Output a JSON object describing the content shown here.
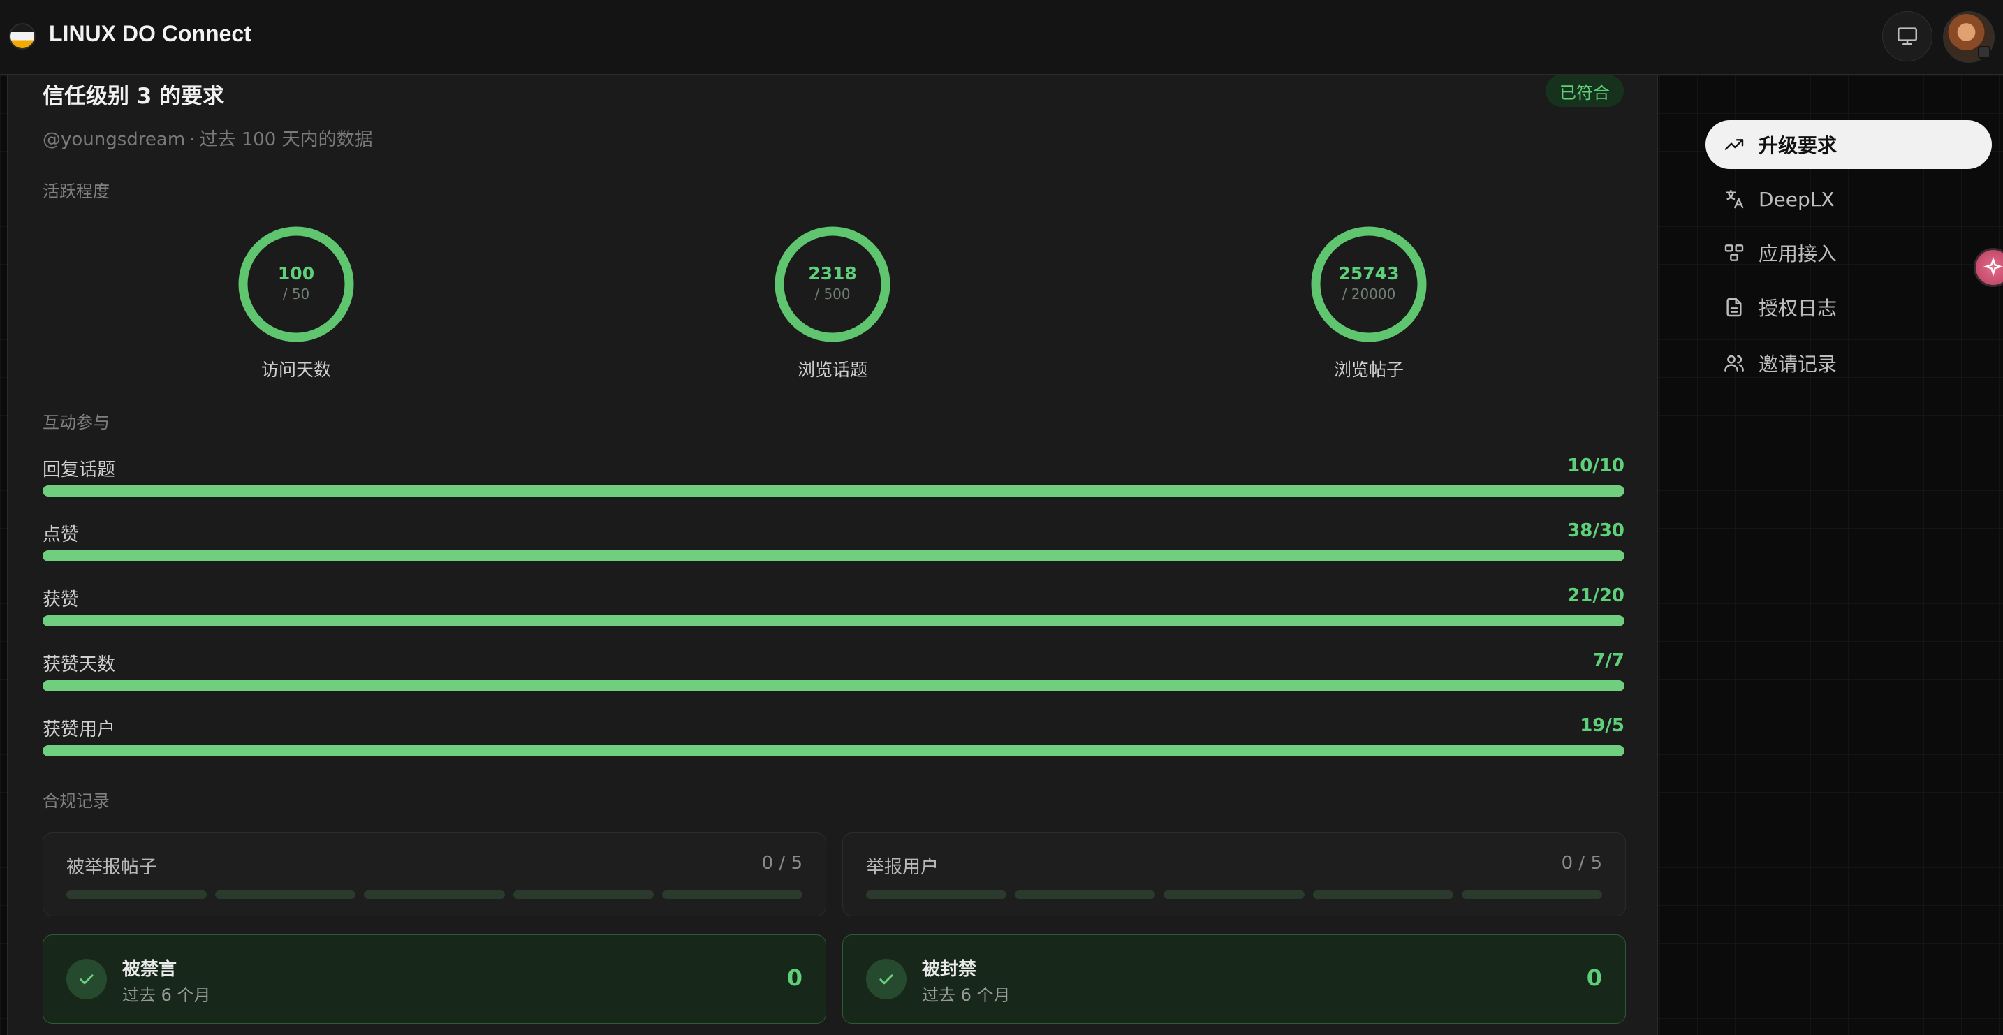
{
  "header": {
    "brand": "LINUX DO Connect",
    "monitor_icon": "monitor-icon",
    "avatar_icon": "user-avatar"
  },
  "panel": {
    "title": "信任级别 3 的要求",
    "status_badge": "已符合",
    "username": "@youngsdream",
    "separator": "·",
    "period": "过去 100 天内的数据",
    "sections": {
      "activity": "活跃程度",
      "interaction": "互动参与",
      "compliance": "合规记录"
    },
    "rings": [
      {
        "value": "100",
        "target": "/ 50",
        "label": "访问天数",
        "progress": 1.0
      },
      {
        "value": "2318",
        "target": "/ 500",
        "label": "浏览话题",
        "progress": 1.0
      },
      {
        "value": "25743",
        "target": "/ 20000",
        "label": "浏览帖子",
        "progress": 1.0
      }
    ],
    "bars": [
      {
        "label": "回复话题",
        "value": "10/10",
        "progress": 1.0
      },
      {
        "label": "点赞",
        "value": "38/30",
        "progress": 1.0
      },
      {
        "label": "获赞",
        "value": "21/20",
        "progress": 1.0
      },
      {
        "label": "获赞天数",
        "value": "7/7",
        "progress": 1.0
      },
      {
        "label": "获赞用户",
        "value": "19/5",
        "progress": 1.0
      }
    ],
    "compliance_cards": [
      {
        "label": "被举报帖子",
        "count": "0 / 5",
        "segments": 5,
        "filled": 0
      },
      {
        "label": "举报用户",
        "count": "0 / 5",
        "segments": 5,
        "filled": 0
      }
    ],
    "status_cards": [
      {
        "title": "被禁言",
        "subtitle": "过去 6 个月",
        "value": "0"
      },
      {
        "title": "被封禁",
        "subtitle": "过去 6 个月",
        "value": "0"
      }
    ]
  },
  "sidebar": {
    "items": [
      {
        "label": "升级要求",
        "icon": "trending-up-icon",
        "active": true
      },
      {
        "label": "DeepLX",
        "icon": "translate-icon",
        "active": false
      },
      {
        "label": "应用接入",
        "icon": "apps-icon",
        "active": false
      },
      {
        "label": "授权日志",
        "icon": "document-icon",
        "active": false
      },
      {
        "label": "邀请记录",
        "icon": "users-icon",
        "active": false
      }
    ]
  },
  "colors": {
    "accent_green": "#5fd07a",
    "bar_fill": "#6fcf7e",
    "track": "#2a3a2d",
    "panel_bg": "#1b1b1b",
    "page_bg": "#0b0b0b"
  }
}
